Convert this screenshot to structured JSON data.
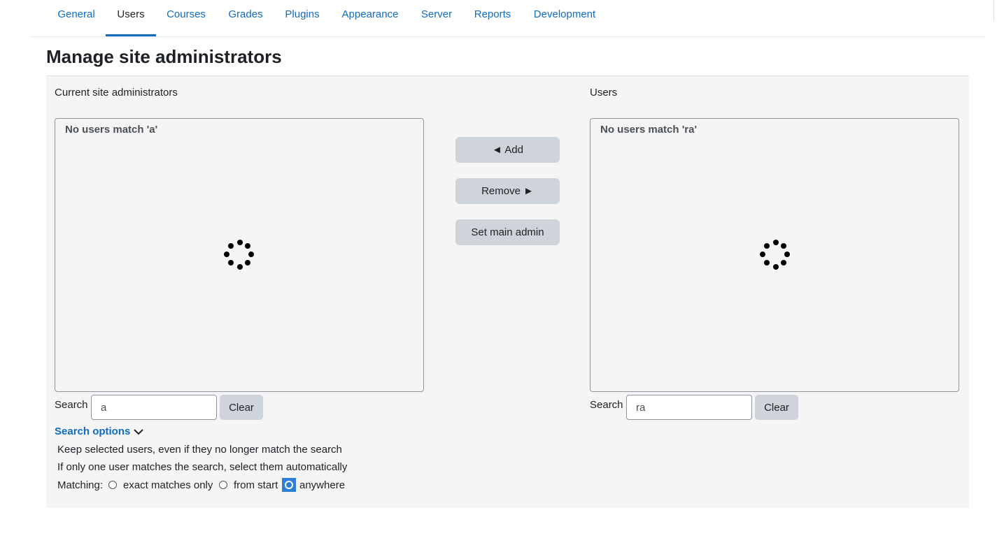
{
  "nav": {
    "tabs": [
      "General",
      "Users",
      "Courses",
      "Grades",
      "Plugins",
      "Appearance",
      "Server",
      "Reports",
      "Development"
    ],
    "active_tab": "Users"
  },
  "page": {
    "title": "Manage site administrators"
  },
  "current_admins": {
    "label": "Current site administrators",
    "empty_message": "No users match 'a'",
    "search_label": "Search",
    "search_value": "a",
    "clear_label": "Clear"
  },
  "users": {
    "label": "Users",
    "empty_message": "No users match 'ra'",
    "search_label": "Search",
    "search_value": "ra",
    "clear_label": "Clear"
  },
  "actions": {
    "add_label": "◄ Add",
    "remove_label": "Remove ►",
    "set_main_admin_label": "Set main admin"
  },
  "search_options": {
    "toggle_label": "Search options",
    "keep_selected": "Keep selected users, even if they no longer match the search",
    "auto_select": "If only one user matches the search, select them automatically",
    "matching_label": "Matching:",
    "matching_options": [
      "exact matches only",
      "from start",
      "anywhere"
    ],
    "matching_selected": "anywhere"
  },
  "colors": {
    "link": "#0f6cbf",
    "button_bg": "#ced4da",
    "panel_bg": "#f5f5f5",
    "radio_selected": "#2d7fd8"
  }
}
